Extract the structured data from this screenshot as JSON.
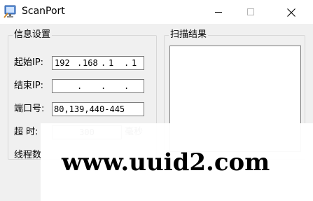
{
  "window": {
    "title": "ScanPort"
  },
  "info_group": {
    "legend": "信息设置",
    "start_ip_label": "起始IP:",
    "start_ip": [
      "192",
      "168",
      "1",
      "1"
    ],
    "end_ip_label": "结束IP:",
    "end_ip": [
      "",
      "",
      "",
      ""
    ],
    "port_label": "端口号:",
    "port_value": "80,139,440-445",
    "timeout_label": "超  时:",
    "timeout_value": "300",
    "timeout_unit": "毫秒",
    "threads_label": "线程数"
  },
  "result_group": {
    "legend": "扫描结果"
  },
  "watermark": "www.uuid2.com",
  "colors": {
    "titlebar": "#ffffff",
    "window_bg": "#f0f0f0",
    "field_border": "#7a7a7a",
    "group_border": "#d7d7d7"
  },
  "icons": [
    "scanport-app-icon",
    "minimize-icon",
    "maximize-icon",
    "close-icon"
  ]
}
